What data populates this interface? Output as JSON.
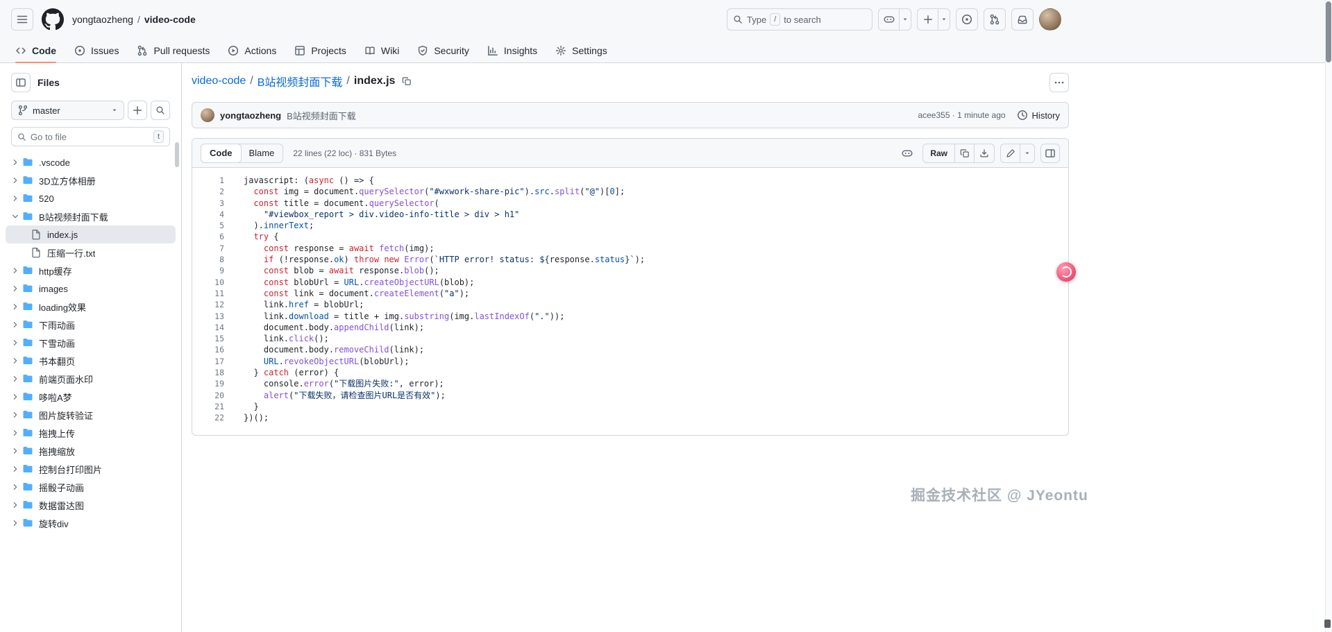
{
  "colors": {
    "header_bg": "#f6f8fa",
    "accent_underline": "#fd8c73",
    "link_blue": "#0969da",
    "folder_icon": "#54aeff",
    "syntax_keyword": "#cf222e",
    "syntax_string": "#0a3069",
    "syntax_function": "#8250df",
    "syntax_constant": "#0550ae"
  },
  "header": {
    "owner": "yongtaozheng",
    "separator": "/",
    "repo": "video-code",
    "search": {
      "pre": "Type",
      "key": "/",
      "post": "to search"
    }
  },
  "repo_nav": {
    "tabs": [
      {
        "label": "Code",
        "icon": "code",
        "active": true
      },
      {
        "label": "Issues",
        "icon": "issue-opened",
        "active": false
      },
      {
        "label": "Pull requests",
        "icon": "git-pull-request",
        "active": false
      },
      {
        "label": "Actions",
        "icon": "play",
        "active": false
      },
      {
        "label": "Projects",
        "icon": "table",
        "active": false
      },
      {
        "label": "Wiki",
        "icon": "book",
        "active": false
      },
      {
        "label": "Security",
        "icon": "shield",
        "active": false
      },
      {
        "label": "Insights",
        "icon": "graph",
        "active": false
      },
      {
        "label": "Settings",
        "icon": "gear",
        "active": false
      }
    ]
  },
  "sidebar": {
    "title": "Files",
    "branch": "master",
    "go_to_file_placeholder": "Go to file",
    "go_to_file_kbd": "t",
    "tree": [
      {
        "name": ".vscode",
        "type": "folder",
        "depth": 0,
        "expanded": false,
        "selected": false
      },
      {
        "name": "3D立方体相册",
        "type": "folder",
        "depth": 0,
        "expanded": false,
        "selected": false
      },
      {
        "name": "520",
        "type": "folder",
        "depth": 0,
        "expanded": false,
        "selected": false
      },
      {
        "name": "B站视频封面下载",
        "type": "folder",
        "depth": 0,
        "expanded": true,
        "selected": false
      },
      {
        "name": "index.js",
        "type": "file",
        "depth": 1,
        "expanded": false,
        "selected": true
      },
      {
        "name": "压缩一行.txt",
        "type": "file",
        "depth": 1,
        "expanded": false,
        "selected": false
      },
      {
        "name": "http缓存",
        "type": "folder",
        "depth": 0,
        "expanded": false,
        "selected": false
      },
      {
        "name": "images",
        "type": "folder",
        "depth": 0,
        "expanded": false,
        "selected": false
      },
      {
        "name": "loading效果",
        "type": "folder",
        "depth": 0,
        "expanded": false,
        "selected": false
      },
      {
        "name": "下雨动画",
        "type": "folder",
        "depth": 0,
        "expanded": false,
        "selected": false
      },
      {
        "name": "下雪动画",
        "type": "folder",
        "depth": 0,
        "expanded": false,
        "selected": false
      },
      {
        "name": "书本翻页",
        "type": "folder",
        "depth": 0,
        "expanded": false,
        "selected": false
      },
      {
        "name": "前端页面水印",
        "type": "folder",
        "depth": 0,
        "expanded": false,
        "selected": false
      },
      {
        "name": "哆啦A梦",
        "type": "folder",
        "depth": 0,
        "expanded": false,
        "selected": false
      },
      {
        "name": "图片旋转验证",
        "type": "folder",
        "depth": 0,
        "expanded": false,
        "selected": false
      },
      {
        "name": "拖拽上传",
        "type": "folder",
        "depth": 0,
        "expanded": false,
        "selected": false
      },
      {
        "name": "拖拽缩放",
        "type": "folder",
        "depth": 0,
        "expanded": false,
        "selected": false
      },
      {
        "name": "控制台打印图片",
        "type": "folder",
        "depth": 0,
        "expanded": false,
        "selected": false
      },
      {
        "name": "摇骰子动画",
        "type": "folder",
        "depth": 0,
        "expanded": false,
        "selected": false
      },
      {
        "name": "数据雷达图",
        "type": "folder",
        "depth": 0,
        "expanded": false,
        "selected": false
      },
      {
        "name": "旋转div",
        "type": "folder",
        "depth": 0,
        "expanded": false,
        "selected": false
      }
    ]
  },
  "main": {
    "breadcrumb": {
      "repo": "video-code",
      "folder": "B站视频封面下载",
      "file": "index.js",
      "separator": "/"
    },
    "commit": {
      "author": "yongtaozheng",
      "message": "B站视频封面下载",
      "sha_time": "acee355 · 1 minute ago",
      "history_label": "History"
    },
    "toolbar": {
      "code_label": "Code",
      "blame_label": "Blame",
      "meta": "22 lines (22 loc) · 831 Bytes",
      "raw_label": "Raw"
    },
    "code_lines": [
      [
        [
          "p",
          "javascript: ("
        ],
        [
          "k",
          "async"
        ],
        [
          "p",
          " () => {"
        ]
      ],
      [
        [
          "p",
          "  "
        ],
        [
          "k",
          "const"
        ],
        [
          "p",
          " img = document."
        ],
        [
          "f",
          "querySelector"
        ],
        [
          "p",
          "("
        ],
        [
          "s",
          "\"#wxwork-share-pic\""
        ],
        [
          "p",
          ")."
        ],
        [
          "c",
          "src"
        ],
        [
          "p",
          "."
        ],
        [
          "f",
          "split"
        ],
        [
          "p",
          "("
        ],
        [
          "s",
          "\"@\""
        ],
        [
          "p",
          ")["
        ],
        [
          "c",
          "0"
        ],
        [
          "p",
          "];"
        ]
      ],
      [
        [
          "p",
          "  "
        ],
        [
          "k",
          "const"
        ],
        [
          "p",
          " title = document."
        ],
        [
          "f",
          "querySelector"
        ],
        [
          "p",
          "("
        ]
      ],
      [
        [
          "p",
          "    "
        ],
        [
          "s",
          "\"#viewbox_report > div.video-info-title > div > h1\""
        ]
      ],
      [
        [
          "p",
          "  )."
        ],
        [
          "c",
          "innerText"
        ],
        [
          "p",
          ";"
        ]
      ],
      [
        [
          "p",
          "  "
        ],
        [
          "k",
          "try"
        ],
        [
          "p",
          " {"
        ]
      ],
      [
        [
          "p",
          "    "
        ],
        [
          "k",
          "const"
        ],
        [
          "p",
          " response = "
        ],
        [
          "k",
          "await"
        ],
        [
          "p",
          " "
        ],
        [
          "f",
          "fetch"
        ],
        [
          "p",
          "(img);"
        ]
      ],
      [
        [
          "p",
          "    "
        ],
        [
          "k",
          "if"
        ],
        [
          "p",
          " (!response."
        ],
        [
          "c",
          "ok"
        ],
        [
          "p",
          ") "
        ],
        [
          "k",
          "throw"
        ],
        [
          "p",
          " "
        ],
        [
          "k",
          "new"
        ],
        [
          "p",
          " "
        ],
        [
          "f",
          "Error"
        ],
        [
          "p",
          "("
        ],
        [
          "s",
          "`HTTP error! status: ${"
        ],
        [
          "p",
          "response."
        ],
        [
          "c",
          "status"
        ],
        [
          "s",
          "}`"
        ],
        [
          "p",
          ");"
        ]
      ],
      [
        [
          "p",
          "    "
        ],
        [
          "k",
          "const"
        ],
        [
          "p",
          " blob = "
        ],
        [
          "k",
          "await"
        ],
        [
          "p",
          " response."
        ],
        [
          "f",
          "blob"
        ],
        [
          "p",
          "();"
        ]
      ],
      [
        [
          "p",
          "    "
        ],
        [
          "k",
          "const"
        ],
        [
          "p",
          " blobUrl = "
        ],
        [
          "c",
          "URL"
        ],
        [
          "p",
          "."
        ],
        [
          "f",
          "createObjectURL"
        ],
        [
          "p",
          "(blob);"
        ]
      ],
      [
        [
          "p",
          "    "
        ],
        [
          "k",
          "const"
        ],
        [
          "p",
          " link = document."
        ],
        [
          "f",
          "createElement"
        ],
        [
          "p",
          "("
        ],
        [
          "s",
          "\"a\""
        ],
        [
          "p",
          ");"
        ]
      ],
      [
        [
          "p",
          "    link."
        ],
        [
          "c",
          "href"
        ],
        [
          "p",
          " = blobUrl;"
        ]
      ],
      [
        [
          "p",
          "    link."
        ],
        [
          "c",
          "download"
        ],
        [
          "p",
          " = title + img."
        ],
        [
          "f",
          "substring"
        ],
        [
          "p",
          "(img."
        ],
        [
          "f",
          "lastIndexOf"
        ],
        [
          "p",
          "("
        ],
        [
          "s",
          "\".\""
        ],
        [
          "p",
          "));"
        ]
      ],
      [
        [
          "p",
          "    document.body."
        ],
        [
          "f",
          "appendChild"
        ],
        [
          "p",
          "(link);"
        ]
      ],
      [
        [
          "p",
          "    link."
        ],
        [
          "f",
          "click"
        ],
        [
          "p",
          "();"
        ]
      ],
      [
        [
          "p",
          "    document.body."
        ],
        [
          "f",
          "removeChild"
        ],
        [
          "p",
          "(link);"
        ]
      ],
      [
        [
          "p",
          "    "
        ],
        [
          "c",
          "URL"
        ],
        [
          "p",
          "."
        ],
        [
          "f",
          "revokeObjectURL"
        ],
        [
          "p",
          "(blobUrl);"
        ]
      ],
      [
        [
          "p",
          "  } "
        ],
        [
          "k",
          "catch"
        ],
        [
          "p",
          " (error) {"
        ]
      ],
      [
        [
          "p",
          "    console."
        ],
        [
          "f",
          "error"
        ],
        [
          "p",
          "("
        ],
        [
          "s",
          "\"下载图片失败:\""
        ],
        [
          "p",
          ", error);"
        ]
      ],
      [
        [
          "p",
          "    "
        ],
        [
          "f",
          "alert"
        ],
        [
          "p",
          "("
        ],
        [
          "s",
          "\"下载失败，请检查图片URL是否有效\""
        ],
        [
          "p",
          ");"
        ]
      ],
      [
        [
          "p",
          "  }"
        ]
      ],
      [
        [
          "p",
          "})();"
        ]
      ]
    ]
  },
  "watermark": "掘金技术社区 @ JYeontu"
}
